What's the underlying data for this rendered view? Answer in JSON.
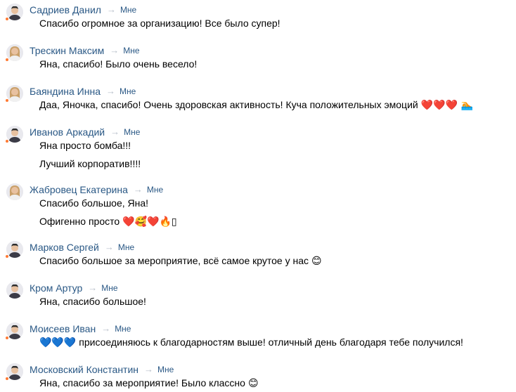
{
  "recipient_label": "Мне",
  "colors": {
    "link": "#2a5885",
    "arrow": "#b6bec8",
    "online": "#ff7a33",
    "text": "#000000"
  },
  "messages": [
    {
      "sender": "Садриев Данил",
      "online": true,
      "avatar": "male-avatar",
      "lines": [
        {
          "text": "Спасибо огромное за организацию! Все было супер!",
          "emoji": ""
        }
      ]
    },
    {
      "sender": "Трескин Максим",
      "online": true,
      "avatar": "female-avatar",
      "lines": [
        {
          "text": "Яна, спасибо! Было очень весело!",
          "emoji": ""
        }
      ]
    },
    {
      "sender": "Баяндина Инна",
      "online": true,
      "avatar": "female-avatar",
      "lines": [
        {
          "text": "Даа, Яночка, спасибо! Очень здоровская активность! Куча положительных эмоций",
          "emoji": "❤️❤️❤️ 🏊"
        }
      ]
    },
    {
      "sender": "Иванов Аркадий",
      "online": true,
      "avatar": "male-avatar",
      "lines": [
        {
          "text": "Яна просто бомба!!!",
          "emoji": ""
        },
        {
          "text": "Лучший корпоратив!!!!",
          "emoji": ""
        }
      ]
    },
    {
      "sender": "Жабровец Екатерина",
      "online": false,
      "avatar": "female-avatar",
      "lines": [
        {
          "text": "Спасибо большое, Яна!",
          "emoji": ""
        },
        {
          "text": "Офигенно просто",
          "emoji": "❤️🥰❤️🔥▯"
        }
      ]
    },
    {
      "sender": "Марков Сергей",
      "online": true,
      "avatar": "male-avatar",
      "lines": [
        {
          "text": "Спасибо большое за мероприятие, всё самое крутое у нас",
          "emoji": "😊"
        }
      ]
    },
    {
      "sender": "Кром Артур",
      "online": false,
      "avatar": "male-avatar",
      "lines": [
        {
          "text": "Яна, спасибо большое!",
          "emoji": ""
        }
      ]
    },
    {
      "sender": "Моисеев Иван",
      "online": true,
      "avatar": "male-avatar",
      "lines": [
        {
          "text": "присоединяюсь к благодарностям выше! отличный день благодаря тебе получился!",
          "emoji_before": "💙💙💙"
        }
      ]
    },
    {
      "sender": "Московский Константин",
      "online": true,
      "avatar": "male-avatar",
      "lines": [
        {
          "text": "Яна, спасибо за мероприятие! Было классно",
          "emoji": "😊"
        }
      ]
    }
  ]
}
